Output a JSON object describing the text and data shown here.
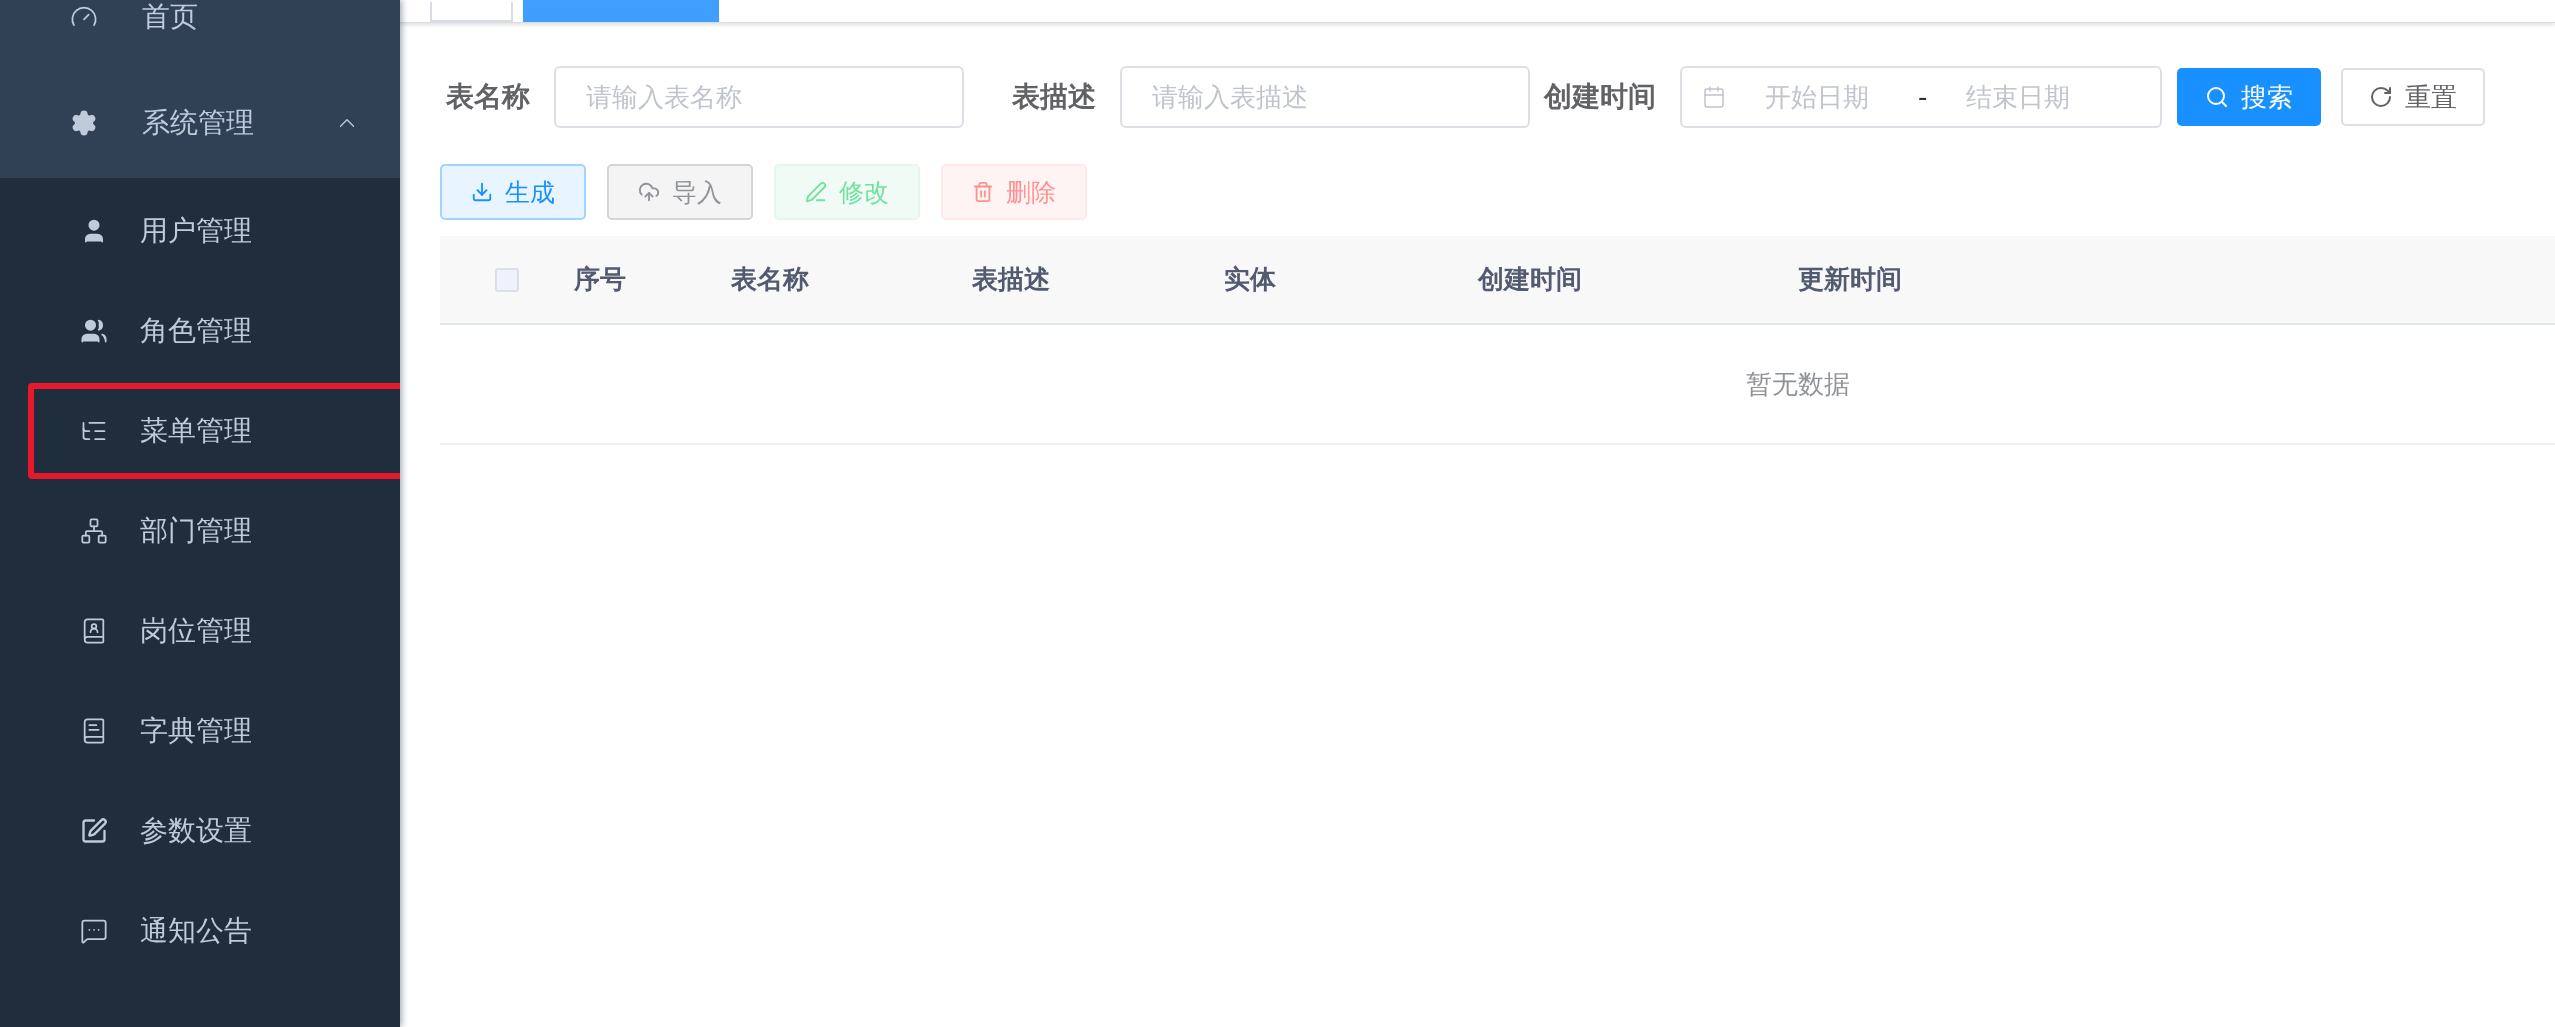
{
  "sidebar": {
    "items": [
      {
        "label": "首页",
        "kind": "link"
      },
      {
        "label": "系统管理",
        "kind": "group",
        "expanded": true,
        "children": [
          {
            "label": "用户管理",
            "highlighted": false
          },
          {
            "label": "角色管理",
            "highlighted": false
          },
          {
            "label": "菜单管理",
            "highlighted": true
          },
          {
            "label": "部门管理",
            "highlighted": false
          },
          {
            "label": "岗位管理",
            "highlighted": false
          },
          {
            "label": "字典管理",
            "highlighted": false
          },
          {
            "label": "参数设置",
            "highlighted": false
          },
          {
            "label": "通知公告",
            "highlighted": false
          }
        ]
      }
    ]
  },
  "tags_view": {
    "tabs": [
      {
        "selected": false
      },
      {
        "selected": true
      }
    ]
  },
  "search_form": {
    "fields": [
      {
        "kind": "text",
        "label": "表名称",
        "placeholder": "请输入表名称"
      },
      {
        "kind": "text",
        "label": "表描述",
        "placeholder": "请输入表描述"
      },
      {
        "kind": "daterange",
        "label": "创建时间",
        "start_placeholder": "开始日期",
        "separator": "-",
        "end_placeholder": "结束日期"
      }
    ],
    "buttons": [
      {
        "kind": "primary",
        "label": "搜索"
      },
      {
        "kind": "default",
        "label": "重置"
      }
    ]
  },
  "toolbar": [
    {
      "kind": "primary",
      "label": "生成"
    },
    {
      "kind": "info",
      "label": "导入"
    },
    {
      "kind": "success",
      "label": "修改"
    },
    {
      "kind": "danger",
      "label": "删除"
    }
  ],
  "table": {
    "select_all": {
      "checked": false
    },
    "columns": [
      "序号",
      "表名称",
      "表描述",
      "实体",
      "创建时间",
      "更新时间"
    ],
    "empty_text": "暂无数据"
  }
}
